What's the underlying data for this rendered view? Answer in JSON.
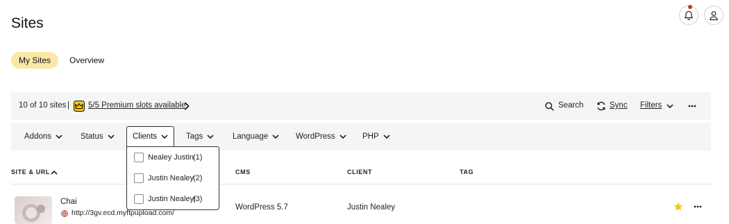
{
  "header": {
    "title": "Sites"
  },
  "tabs": [
    {
      "label": "My Sites",
      "active": true
    },
    {
      "label": "Overview",
      "active": false
    }
  ],
  "summary": {
    "count": "10 of 10 sites",
    "separator": "|",
    "premium_slots": "5/5 Premium slots available",
    "search_label": "Search",
    "sync_label": "Sync",
    "filters_label": "Filters"
  },
  "filters": [
    {
      "label": "Addons"
    },
    {
      "label": "Status"
    },
    {
      "label": "Clients"
    },
    {
      "label": "Tags"
    },
    {
      "label": "Language"
    },
    {
      "label": "WordPress"
    },
    {
      "label": "PHP"
    }
  ],
  "clients_dropdown": {
    "options": [
      {
        "label": "Nealey Justin",
        "count": "(1)",
        "checked": false
      },
      {
        "label": "Justin Nealey",
        "count": "(2)",
        "checked": false
      },
      {
        "label": "Justin Nealey!",
        "count": "(3)",
        "checked": false
      }
    ]
  },
  "table": {
    "columns": [
      "SITE & URL",
      "CMS",
      "CLIENT",
      "TAG"
    ],
    "rows": [
      {
        "name": "Chai",
        "url": "http://3gv.ecd.myftpupload.com/",
        "cms": "WordPress 5.7",
        "client": "Justin Nealey",
        "tag": "",
        "favorite": true
      }
    ]
  },
  "colors": {
    "tab_active_bg": "#fbe7a6",
    "bar_bg": "#f4f5f5",
    "premium_icon": "#f5c518",
    "favorite_star": "#f5c518",
    "notification_dot": "#c0392b"
  }
}
